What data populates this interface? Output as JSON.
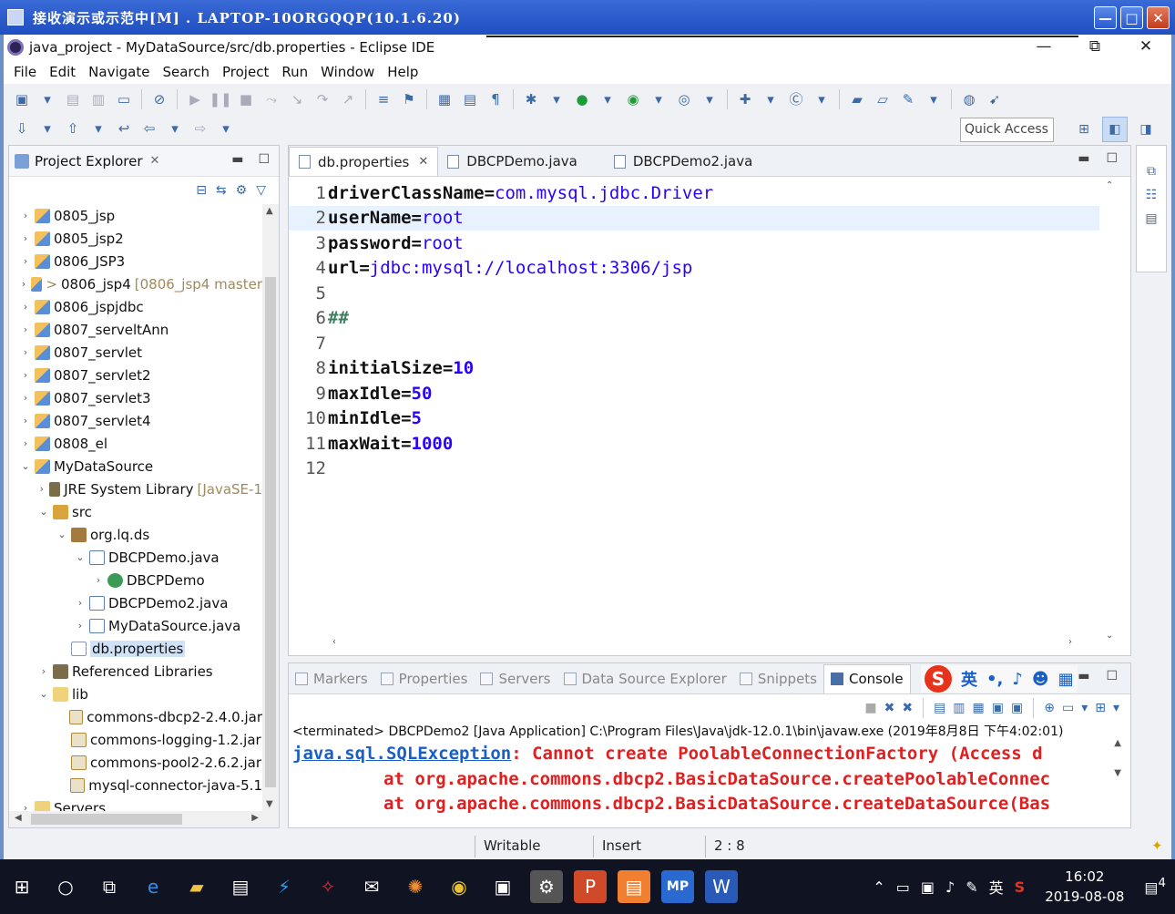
{
  "remote_window": {
    "title": "接收演示或示范中[M] . LAPTOP-10ORGQQP(10.1.6.20)",
    "controls": [
      "—",
      "□",
      "✕"
    ]
  },
  "eclipse_window": {
    "title": "java_project - MyDataSource/src/db.properties - Eclipse IDE",
    "controls": [
      "—",
      "⧉",
      "✕"
    ]
  },
  "menu": [
    "File",
    "Edit",
    "Navigate",
    "Search",
    "Project",
    "Run",
    "Window",
    "Help"
  ],
  "quick_access": {
    "placeholder": "Quick Access"
  },
  "project_explorer": {
    "title": "Project Explorer",
    "tree": [
      {
        "label": "0805_jsp",
        "indent": 0,
        "twisty": "›",
        "icon": "project-icon"
      },
      {
        "label": "0805_jsp2",
        "indent": 0,
        "twisty": "›",
        "icon": "project-icon"
      },
      {
        "label": "0806_JSP3",
        "indent": 0,
        "twisty": "›",
        "icon": "project-icon"
      },
      {
        "label": "0806_jsp4",
        "indent": 0,
        "twisty": "›",
        "icon": "project-icon",
        "prefix": ">",
        "decoration": "[0806_jsp4 master"
      },
      {
        "label": "0806_jspjdbc",
        "indent": 0,
        "twisty": "›",
        "icon": "project-icon"
      },
      {
        "label": "0807_serveltAnn",
        "indent": 0,
        "twisty": "›",
        "icon": "project-icon"
      },
      {
        "label": "0807_servlet",
        "indent": 0,
        "twisty": "›",
        "icon": "project-icon"
      },
      {
        "label": "0807_servlet2",
        "indent": 0,
        "twisty": "›",
        "icon": "project-icon"
      },
      {
        "label": "0807_servlet3",
        "indent": 0,
        "twisty": "›",
        "icon": "project-icon"
      },
      {
        "label": "0807_servlet4",
        "indent": 0,
        "twisty": "›",
        "icon": "project-icon"
      },
      {
        "label": "0808_el",
        "indent": 0,
        "twisty": "›",
        "icon": "project-icon"
      },
      {
        "label": "MyDataSource",
        "indent": 0,
        "twisty": "⌄",
        "icon": "project-icon"
      },
      {
        "label": "JRE System Library",
        "indent": 1,
        "twisty": "›",
        "icon": "library-icon",
        "decoration": "[JavaSE-1"
      },
      {
        "label": "src",
        "indent": 1,
        "twisty": "⌄",
        "icon": "source-folder-icon"
      },
      {
        "label": "org.lq.ds",
        "indent": 2,
        "twisty": "⌄",
        "icon": "package-icon"
      },
      {
        "label": "DBCPDemo.java",
        "indent": 3,
        "twisty": "⌄",
        "icon": "java-file-icon"
      },
      {
        "label": "DBCPDemo",
        "indent": 4,
        "twisty": "›",
        "icon": "class-icon"
      },
      {
        "label": "DBCPDemo2.java",
        "indent": 3,
        "twisty": "›",
        "icon": "java-file-icon"
      },
      {
        "label": "MyDataSource.java",
        "indent": 3,
        "twisty": "›",
        "icon": "java-file-icon"
      },
      {
        "label": "db.properties",
        "indent": 2,
        "twisty": "",
        "icon": "properties-file-icon",
        "selected": true
      },
      {
        "label": "Referenced Libraries",
        "indent": 1,
        "twisty": "›",
        "icon": "library-icon"
      },
      {
        "label": "lib",
        "indent": 1,
        "twisty": "⌄",
        "icon": "folder-icon"
      },
      {
        "label": "commons-dbcp2-2.4.0.jar",
        "indent": 2,
        "twisty": "",
        "icon": "jar-icon"
      },
      {
        "label": "commons-logging-1.2.jar",
        "indent": 2,
        "twisty": "",
        "icon": "jar-icon"
      },
      {
        "label": "commons-pool2-2.6.2.jar",
        "indent": 2,
        "twisty": "",
        "icon": "jar-icon"
      },
      {
        "label": "mysql-connector-java-5.1",
        "indent": 2,
        "twisty": "",
        "icon": "jar-icon"
      },
      {
        "label": "Servers",
        "indent": 0,
        "twisty": "›",
        "icon": "folder-icon"
      }
    ]
  },
  "editor": {
    "tabs": [
      {
        "label": "db.properties",
        "active": true,
        "closable": true
      },
      {
        "label": "DBCPDemo.java",
        "active": false
      },
      {
        "label": "DBCPDemo2.java",
        "active": false
      }
    ],
    "lines": [
      {
        "no": "1",
        "key": "driverClassName=",
        "value": "com.mysql.jdbc.Driver",
        "kind": "str"
      },
      {
        "no": "2",
        "key": "userName=",
        "value": "root",
        "kind": "str",
        "current": true
      },
      {
        "no": "3",
        "key": "password=",
        "value": "root",
        "kind": "str"
      },
      {
        "no": "4",
        "key": "url=",
        "value": "jdbc:mysql://localhost:3306/jsp",
        "kind": "str"
      },
      {
        "no": "5",
        "key": "",
        "value": "",
        "kind": ""
      },
      {
        "no": "6",
        "key": "",
        "value": "##",
        "kind": "comment"
      },
      {
        "no": "7",
        "key": "",
        "value": "",
        "kind": ""
      },
      {
        "no": "8",
        "key": "initialSize=",
        "value": "10",
        "kind": "num"
      },
      {
        "no": "9",
        "key": "maxIdle=",
        "value": "50",
        "kind": "num"
      },
      {
        "no": "10",
        "key": "minIdle=",
        "value": "5",
        "kind": "num"
      },
      {
        "no": "11",
        "key": "maxWait=",
        "value": "1000",
        "kind": "num"
      },
      {
        "no": "12",
        "key": "",
        "value": "",
        "kind": ""
      }
    ]
  },
  "bottom_panel": {
    "tabs": [
      "Markers",
      "Properties",
      "Servers",
      "Data Source Explorer",
      "Snippets",
      "Console"
    ],
    "active_tab": "Console",
    "ime": {
      "lang": "英",
      "punct": "•,"
    },
    "terminated": "<terminated> DBCPDemo2 [Java Application] C:\\Program Files\\Java\\jdk-12.0.1\\bin\\javaw.exe (2019年8月8日 下午4:02:01)",
    "error_link": "java.sql.SQLException",
    "error_msg": ": Cannot create PoolableConnectionFactory (Access d",
    "stack": [
      "at org.apache.commons.dbcp2.BasicDataSource.createPoolableConnec",
      "at org.apache.commons.dbcp2.BasicDataSource.createDataSource(Bas"
    ]
  },
  "status_bar": {
    "writable": "Writable",
    "insert": "Insert",
    "position": "2 : 8"
  },
  "taskbar": {
    "time": "16:02",
    "date": "2019-08-08",
    "ime_lang": "英",
    "notification_count": "4"
  }
}
